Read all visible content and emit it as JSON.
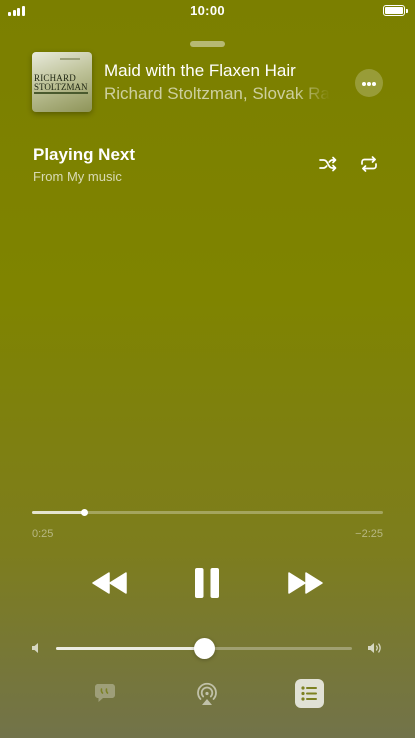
{
  "status_bar": {
    "time": "10:00",
    "signal_icon": "signal-icon",
    "battery_icon": "battery-icon"
  },
  "now_playing": {
    "artwork_text_line1": "RICHARD",
    "artwork_text_line2": "STOLTZMAN",
    "title": "Maid with the Flaxen Hair",
    "artist": "Richard Stoltzman, Slovak Radio",
    "more_icon": "ellipsis-icon"
  },
  "queue": {
    "heading": "Playing Next",
    "source": "From My music",
    "shuffle_icon": "shuffle-icon",
    "repeat_icon": "repeat-icon"
  },
  "progress": {
    "elapsed": "0:25",
    "remaining": "−2:25",
    "fraction": 0.147
  },
  "controls": {
    "rewind_icon": "rewind-icon",
    "pause_icon": "pause-icon",
    "forward_icon": "fast-forward-icon"
  },
  "volume": {
    "level": 0.5,
    "low_icon": "speaker-low-icon",
    "high_icon": "speaker-high-icon"
  },
  "bottom_bar": {
    "lyrics_icon": "lyrics-icon",
    "airplay_icon": "airplay-icon",
    "queue_icon": "queue-list-icon"
  },
  "colors": {
    "background_top": "#7b7f00",
    "background_bottom": "#72734a",
    "accent": "#ffffff"
  }
}
